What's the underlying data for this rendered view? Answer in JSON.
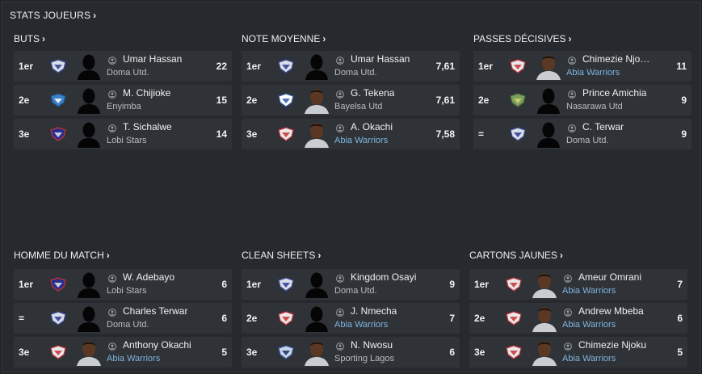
{
  "header": {
    "title": "STATS JOUEURS"
  },
  "panels": [
    {
      "title": "BUTS",
      "rows": [
        {
          "rank": "1er",
          "name": "Umar Hassan",
          "club": "Doma Utd.",
          "value": "22",
          "badge": "doma",
          "avatar": "silhouette",
          "club_style": "grey"
        },
        {
          "rank": "2e",
          "name": "M. Chijioke",
          "club": "Enyimba",
          "value": "15",
          "badge": "enyimba",
          "avatar": "silhouette",
          "club_style": "grey"
        },
        {
          "rank": "3e",
          "name": "T. Sichalwe",
          "club": "Lobi Stars",
          "value": "14",
          "badge": "lobi",
          "avatar": "silhouette",
          "club_style": "grey"
        }
      ]
    },
    {
      "title": "NOTE MOYENNE",
      "rows": [
        {
          "rank": "1er",
          "name": "Umar Hassan",
          "club": "Doma Utd.",
          "value": "7,61",
          "badge": "doma",
          "avatar": "silhouette",
          "club_style": "grey"
        },
        {
          "rank": "2e",
          "name": "G. Tekena",
          "club": "Bayelsa Utd",
          "value": "7,61",
          "badge": "bayelsa",
          "avatar": "photo",
          "club_style": "grey"
        },
        {
          "rank": "3e",
          "name": "A. Okachi",
          "club": "Abia Warriors",
          "value": "7,58",
          "badge": "abia",
          "avatar": "photo",
          "club_style": "blue"
        }
      ]
    },
    {
      "title": "PASSES DÉCISIVES",
      "rows": [
        {
          "rank": "1er",
          "name": "Chimezie Njo…",
          "club": "Abia Warriors",
          "value": "11",
          "badge": "abia",
          "avatar": "photo",
          "club_style": "blue"
        },
        {
          "rank": "2e",
          "name": "Prince Amichia",
          "club": "Nasarawa Utd",
          "value": "9",
          "badge": "nasarawa",
          "avatar": "silhouette",
          "club_style": "grey"
        },
        {
          "rank": "=",
          "name": "C. Terwar",
          "club": "Doma Utd.",
          "value": "9",
          "badge": "doma",
          "avatar": "silhouette",
          "club_style": "grey"
        }
      ]
    },
    {
      "title": "HOMME DU MATCH",
      "rows": [
        {
          "rank": "1er",
          "name": "W. Adebayo",
          "club": "Lobi Stars",
          "value": "6",
          "badge": "lobi",
          "avatar": "silhouette",
          "club_style": "grey"
        },
        {
          "rank": "=",
          "name": "Charles Terwar",
          "club": "Doma Utd.",
          "value": "6",
          "badge": "doma",
          "avatar": "silhouette",
          "club_style": "grey"
        },
        {
          "rank": "3e",
          "name": "Anthony Okachi",
          "club": "Abia Warriors",
          "value": "5",
          "badge": "abia",
          "avatar": "photo",
          "club_style": "blue"
        }
      ]
    },
    {
      "title": "CLEAN SHEETS",
      "rows": [
        {
          "rank": "1er",
          "name": "Kingdom Osayi",
          "club": "Doma Utd.",
          "value": "9",
          "badge": "doma",
          "avatar": "silhouette",
          "club_style": "grey"
        },
        {
          "rank": "2e",
          "name": "J. Nmecha",
          "club": "Abia Warriors",
          "value": "7",
          "badge": "abia",
          "avatar": "silhouette",
          "club_style": "blue"
        },
        {
          "rank": "3e",
          "name": "N. Nwosu",
          "club": "Sporting Lagos",
          "value": "6",
          "badge": "sporting",
          "avatar": "photo",
          "club_style": "grey"
        }
      ]
    },
    {
      "title": "CARTONS JAUNES",
      "rows": [
        {
          "rank": "1er",
          "name": "Ameur Omrani",
          "club": "Abia Warriors",
          "value": "7",
          "badge": "abia",
          "avatar": "photo",
          "club_style": "blue"
        },
        {
          "rank": "2e",
          "name": "Andrew Mbeba",
          "club": "Abia Warriors",
          "value": "6",
          "badge": "abia",
          "avatar": "photo",
          "club_style": "blue"
        },
        {
          "rank": "3e",
          "name": "Chimezie Njoku",
          "club": "Abia Warriors",
          "value": "5",
          "badge": "abia",
          "avatar": "photo",
          "club_style": "blue"
        }
      ]
    }
  ],
  "colors": {
    "background": "#232629",
    "row": "#2f3337",
    "link_blue": "#7fb3e0",
    "muted": "#b8bcc0"
  },
  "icons": {
    "person": "person-icon",
    "chevron": "chevron-right-icon"
  }
}
